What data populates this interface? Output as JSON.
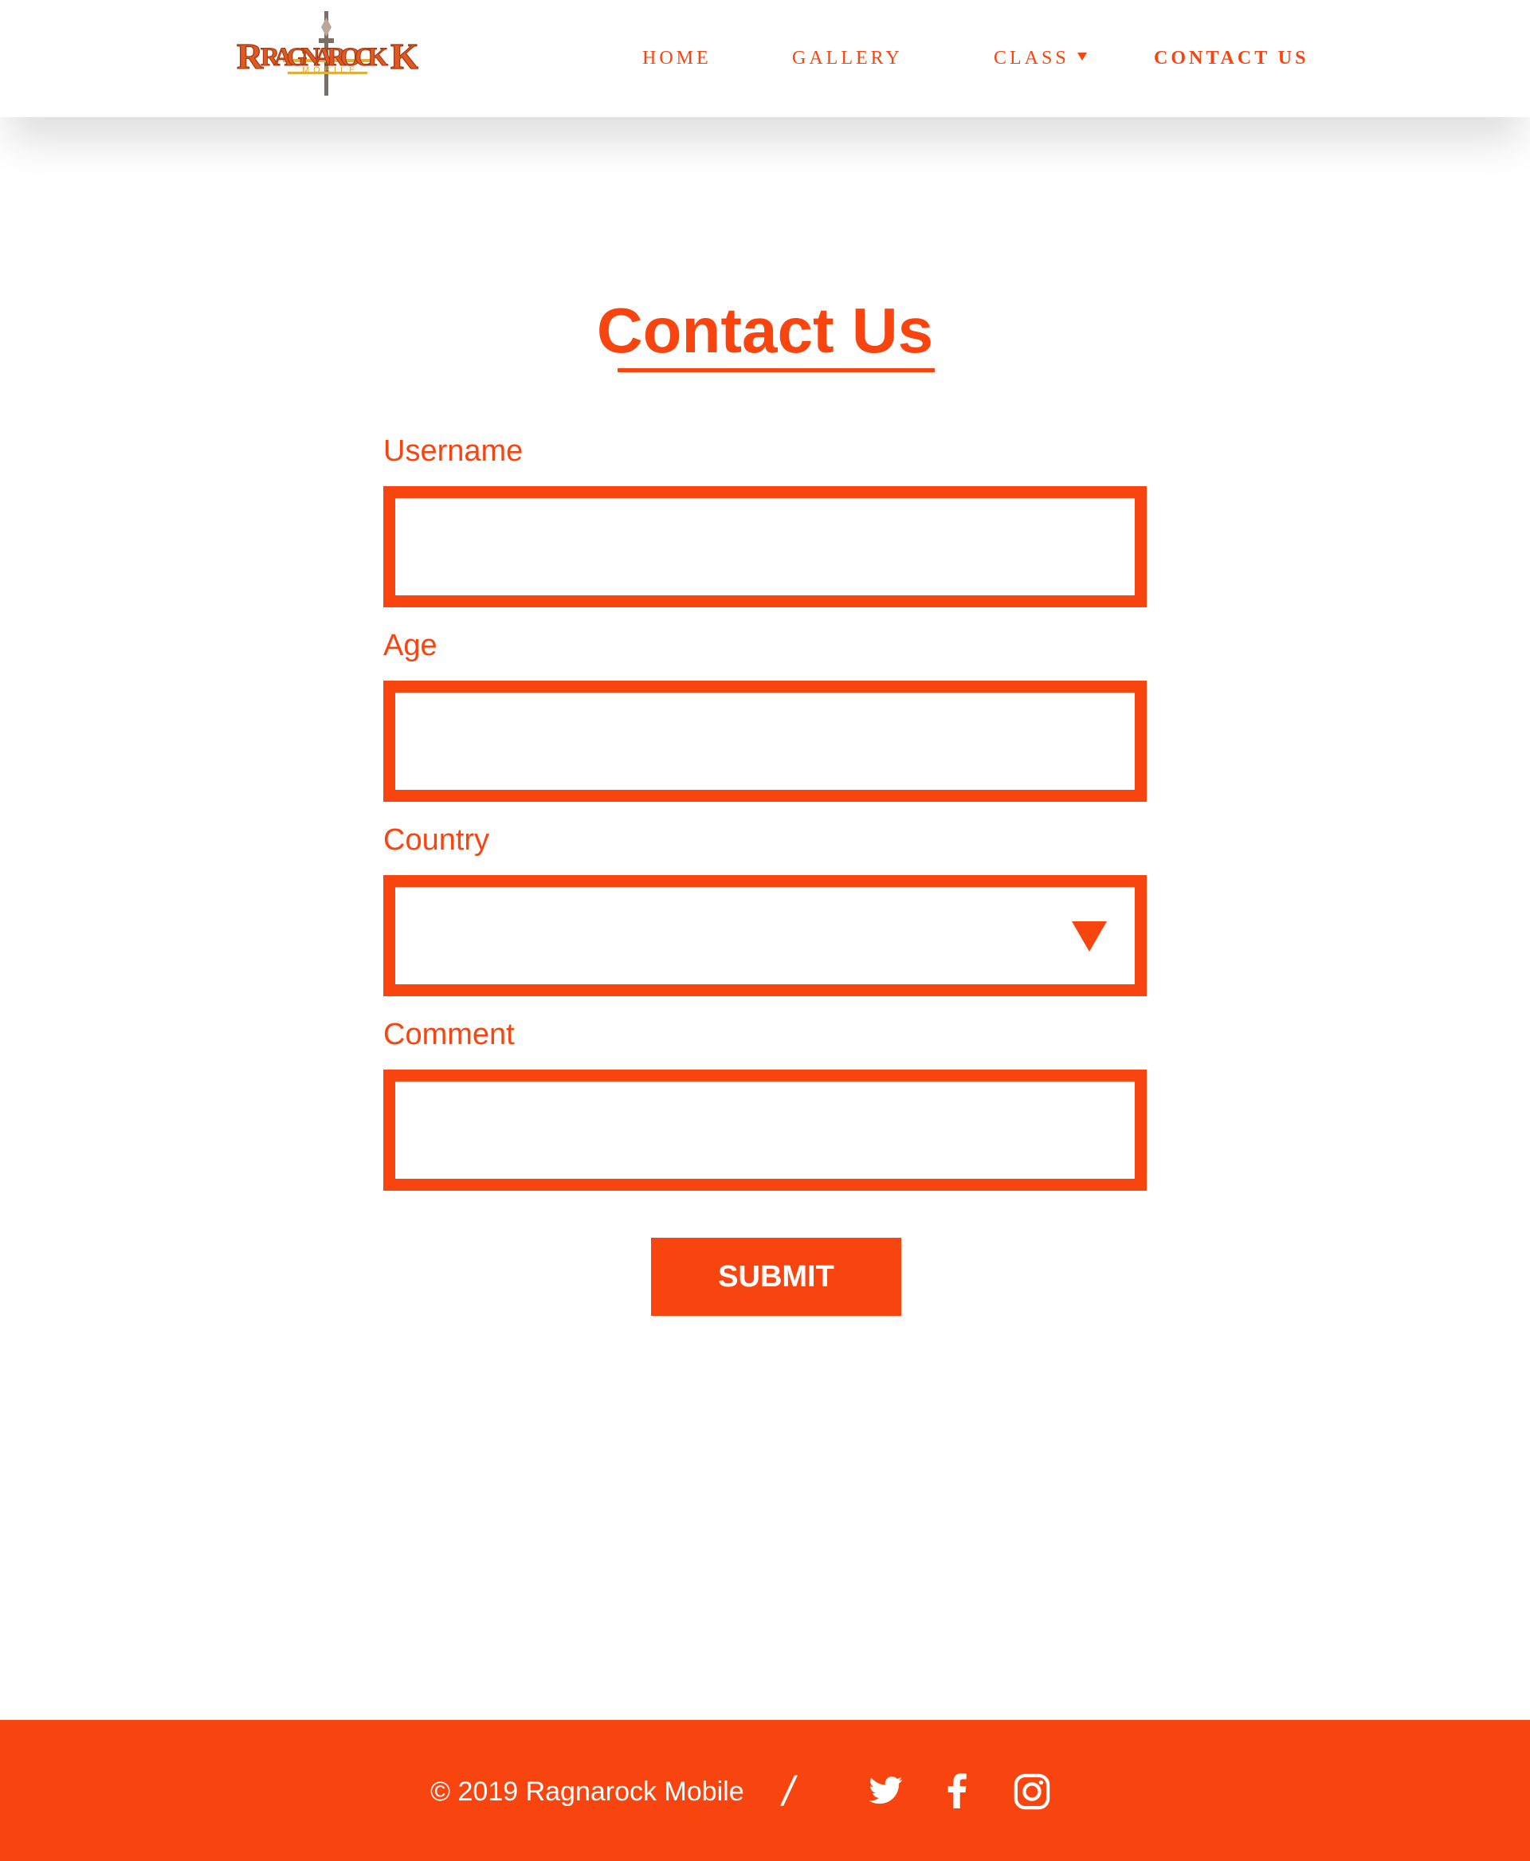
{
  "brand": {
    "logo_text": "RAGNAROCK",
    "logo_subtext": "MOBILE",
    "color": "#f8450f"
  },
  "nav": {
    "home": "HOME",
    "gallery": "GALLERY",
    "class": "CLASS",
    "contact": "CONTACT US"
  },
  "page": {
    "title": "Contact Us"
  },
  "form": {
    "username_label": "Username",
    "username_value": "",
    "age_label": "Age",
    "age_value": "",
    "country_label": "Country",
    "country_value": "",
    "comment_label": "Comment",
    "comment_value": "",
    "submit_label": "SUBMIT"
  },
  "footer": {
    "copyright": "© 2019 Ragnarock Mobile",
    "divider": "/",
    "social": [
      "twitter-icon",
      "facebook-icon",
      "instagram-icon"
    ]
  }
}
